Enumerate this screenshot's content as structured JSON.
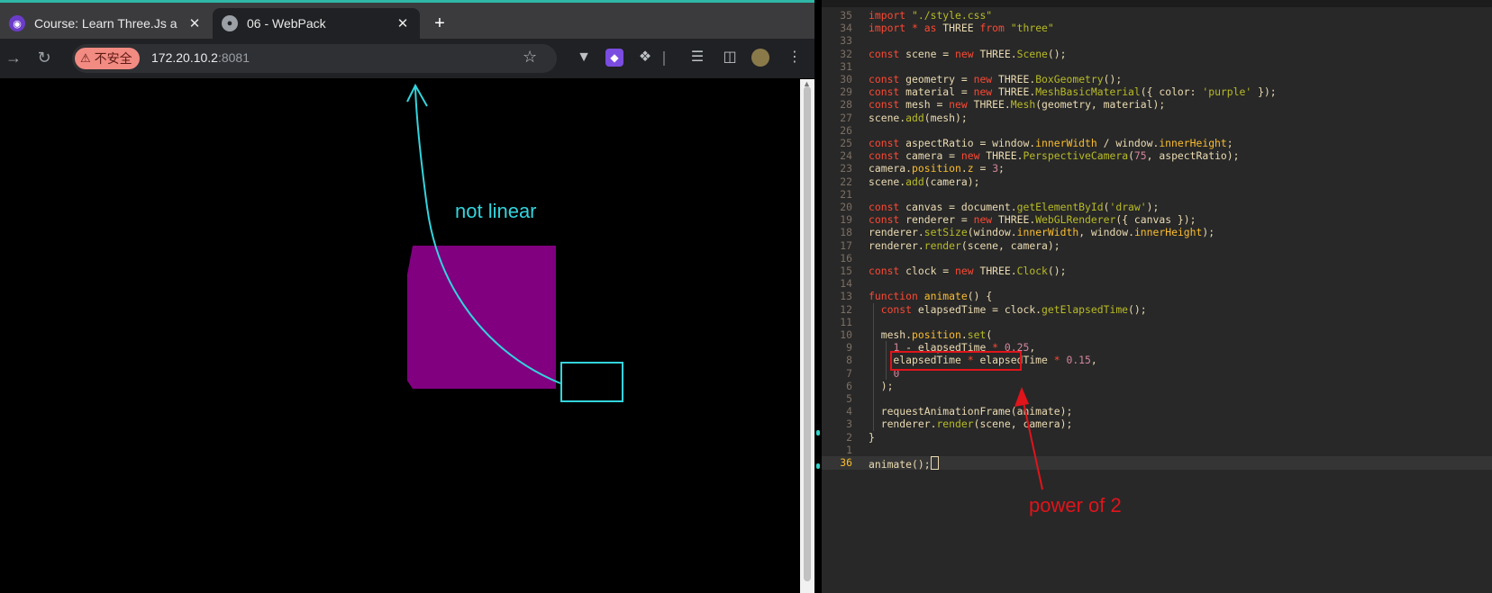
{
  "browser": {
    "tabs": [
      {
        "label": "Course: Learn Three.Js a",
        "active": false,
        "icon": "course-favicon-icon"
      },
      {
        "label": "06 - WebPack",
        "active": true,
        "icon": "globe-icon"
      }
    ],
    "new_tab_glyph": "+",
    "security_label": "不安全",
    "url_host": "172.20.10.2",
    "url_port": ":8081"
  },
  "scene": {
    "cube_color": "#800080",
    "annotation_color": "#33d4dd",
    "annotation_text": "not linear"
  },
  "editor": {
    "lines": [
      {
        "n": "35",
        "code": "import \"./style.css\""
      },
      {
        "n": "34",
        "code": "import * as THREE from \"three\""
      },
      {
        "n": "33",
        "code": ""
      },
      {
        "n": "32",
        "code": "const scene = new THREE.Scene();"
      },
      {
        "n": "31",
        "code": ""
      },
      {
        "n": "30",
        "code": "const geometry = new THREE.BoxGeometry();"
      },
      {
        "n": "29",
        "code": "const material = new THREE.MeshBasicMaterial({ color: 'purple' });"
      },
      {
        "n": "28",
        "code": "const mesh = new THREE.Mesh(geometry, material);"
      },
      {
        "n": "27",
        "code": "scene.add(mesh);"
      },
      {
        "n": "26",
        "code": ""
      },
      {
        "n": "25",
        "code": "const aspectRatio = window.innerWidth / window.innerHeight;"
      },
      {
        "n": "24",
        "code": "const camera = new THREE.PerspectiveCamera(75, aspectRatio);"
      },
      {
        "n": "23",
        "code": "camera.position.z = 3;"
      },
      {
        "n": "22",
        "code": "scene.add(camera);"
      },
      {
        "n": "21",
        "code": ""
      },
      {
        "n": "20",
        "code": "const canvas = document.getElementById('draw');"
      },
      {
        "n": "19",
        "code": "const renderer = new THREE.WebGLRenderer({ canvas });"
      },
      {
        "n": "18",
        "code": "renderer.setSize(window.innerWidth, window.innerHeight);"
      },
      {
        "n": "17",
        "code": "renderer.render(scene, camera);"
      },
      {
        "n": "16",
        "code": ""
      },
      {
        "n": "15",
        "code": "const clock = new THREE.Clock();"
      },
      {
        "n": "14",
        "code": ""
      },
      {
        "n": "13",
        "code": "function animate() {"
      },
      {
        "n": "12",
        "code": "  const elapsedTime = clock.getElapsedTime();"
      },
      {
        "n": "11",
        "code": ""
      },
      {
        "n": "10",
        "code": "  mesh.position.set("
      },
      {
        "n": "9",
        "code": "    1 - elapsedTime * 0.25,"
      },
      {
        "n": "8",
        "code": "    elapsedTime * elapsedTime * 0.15,"
      },
      {
        "n": "7",
        "code": "    0"
      },
      {
        "n": "6",
        "code": "  );"
      },
      {
        "n": "5",
        "code": ""
      },
      {
        "n": "4",
        "code": "  requestAnimationFrame(animate);"
      },
      {
        "n": "3",
        "code": "  renderer.render(scene, camera);"
      },
      {
        "n": "2",
        "code": "}"
      },
      {
        "n": "1",
        "code": ""
      },
      {
        "n": "36",
        "code": "animate();",
        "current": true
      }
    ],
    "annotation_text": "power of 2",
    "annotation_color": "#e0141b"
  }
}
